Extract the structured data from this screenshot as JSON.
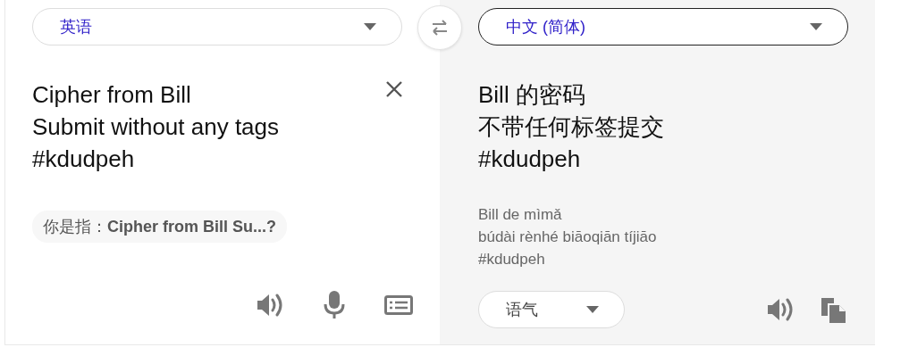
{
  "source_language": {
    "label": "英语",
    "active": false
  },
  "target_language": {
    "label": "中文 (简体)",
    "active": true
  },
  "source_text": [
    "Cipher from Bill",
    "Submit without any tags",
    "#kdudpeh"
  ],
  "did_you_mean": "你是指：**Cipher from Bill Su...?**",
  "translation": [
    "Bill 的密码",
    "不带任何标签提交",
    "#kdudpeh"
  ],
  "pinyin": [
    "Bill de mìmǎ",
    "búdài rènhé biāoqiān tíjiāo",
    "#kdudpeh"
  ],
  "tone_dropdown": {
    "label": "语气"
  }
}
